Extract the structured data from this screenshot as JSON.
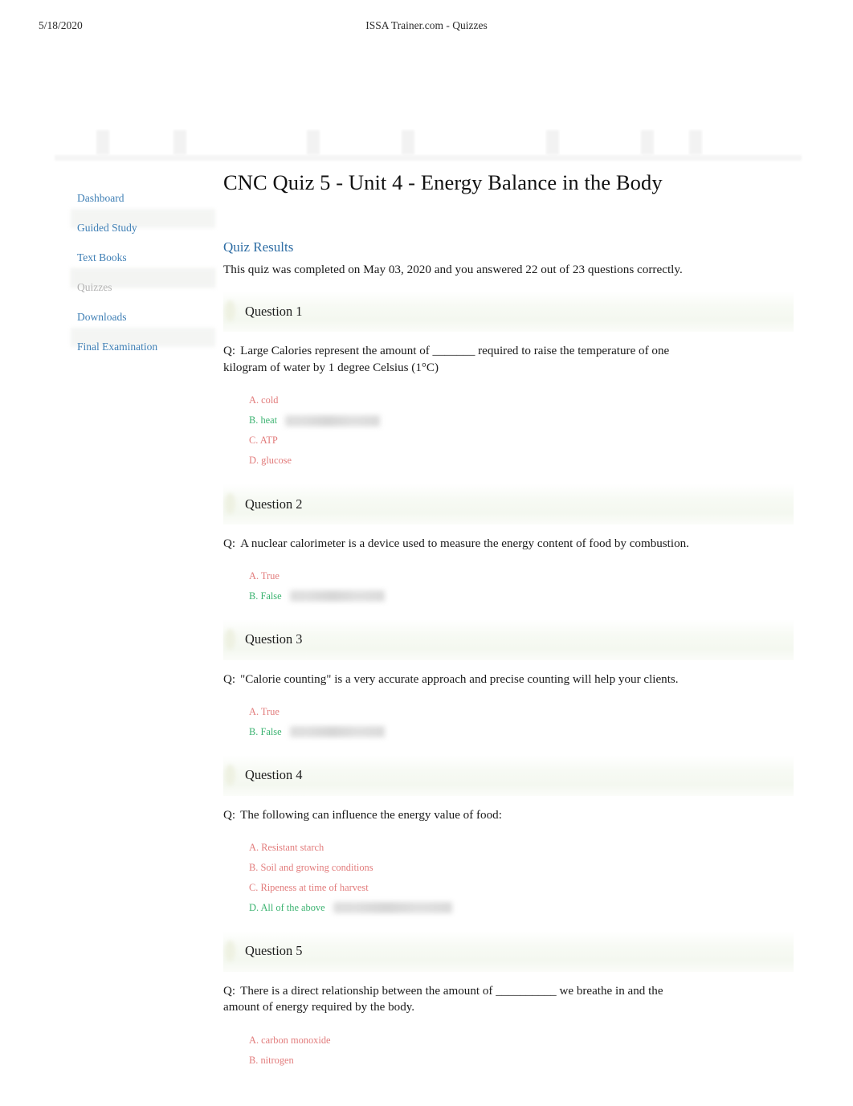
{
  "print_header": {
    "date": "5/18/2020",
    "title": "ISSA Trainer.com - Quizzes"
  },
  "sidebar": {
    "items": [
      {
        "label": "Dashboard",
        "state": "link"
      },
      {
        "label": "Guided Study",
        "state": "link"
      },
      {
        "label": "Text Books",
        "state": "link"
      },
      {
        "label": "Quizzes",
        "state": "current"
      },
      {
        "label": "Downloads",
        "state": "link"
      },
      {
        "label": "Final Examination",
        "state": "link"
      }
    ]
  },
  "main": {
    "quiz_title": "CNC Quiz 5 - Unit 4 - Energy Balance in the Body",
    "results_heading": "Quiz Results",
    "results_summary": "This quiz was completed on May 03, 2020 and you answered 22 out of 23 questions correctly.",
    "question_marker": "Q:",
    "questions": [
      {
        "header": "Question 1",
        "text": "Large Calories represent the amount of _______ required to raise the temperature of one kilogram of water by 1 degree Celsius (1°C)",
        "choices": [
          {
            "label": "A. cold",
            "correct": false,
            "badge": false
          },
          {
            "label": "B. heat",
            "correct": true,
            "badge": true
          },
          {
            "label": "C. ATP",
            "correct": false,
            "badge": false
          },
          {
            "label": "D. glucose",
            "correct": false,
            "badge": false
          }
        ]
      },
      {
        "header": "Question 2",
        "text": "A nuclear calorimeter is a device used to measure the energy content of food by combustion.",
        "choices": [
          {
            "label": "A. True",
            "correct": false,
            "badge": false
          },
          {
            "label": "B. False",
            "correct": true,
            "badge": true
          }
        ]
      },
      {
        "header": "Question 3",
        "text": "\"Calorie counting\" is a very accurate approach and precise counting will help your clients.",
        "choices": [
          {
            "label": "A. True",
            "correct": false,
            "badge": false
          },
          {
            "label": "B. False",
            "correct": true,
            "badge": true
          }
        ]
      },
      {
        "header": "Question 4",
        "text": "The following can influence the energy value of food:",
        "choices": [
          {
            "label": "A. Resistant starch",
            "correct": false,
            "badge": false
          },
          {
            "label": "B. Soil and growing conditions",
            "correct": false,
            "badge": false
          },
          {
            "label": "C. Ripeness at time of harvest",
            "correct": false,
            "badge": false
          },
          {
            "label": "D. All of the above",
            "correct": true,
            "badge": true
          }
        ]
      },
      {
        "header": "Question 5",
        "text": "There is a direct relationship between the amount of __________ we breathe in and the amount of energy required by the body.",
        "choices": [
          {
            "label": "A. carbon monoxide",
            "correct": false,
            "badge": false
          },
          {
            "label": "B. nitrogen",
            "correct": false,
            "badge": false
          }
        ]
      }
    ]
  },
  "colors": {
    "link_blue": "#3f7fb5",
    "heading_blue": "#2e6da4",
    "answer_incorrect": "#e27c7c",
    "answer_correct": "#3cb371",
    "muted_gray": "#b2b2b2",
    "panel_green": "#f4f8f0"
  }
}
